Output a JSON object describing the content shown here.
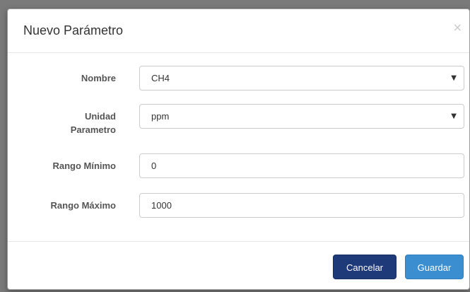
{
  "modal": {
    "title": "Nuevo Parámetro",
    "close_label": "×"
  },
  "form": {
    "fields": [
      {
        "label": "Nombre",
        "type": "select",
        "value": "CH4"
      },
      {
        "label_line1": "Unidad",
        "label_line2": "Parametro",
        "type": "select",
        "value": "ppm"
      },
      {
        "label": "Rango Mínimo",
        "type": "input",
        "value": "0"
      },
      {
        "label": "Rango Máximo",
        "type": "input",
        "value": "1000"
      }
    ],
    "select_arrow": "▼"
  },
  "footer": {
    "cancel_label": "Cancelar",
    "save_label": "Guardar"
  },
  "colors": {
    "cancel_button": "#1e3a78",
    "save_button": "#3b8fd0",
    "backdrop": "#7a7a7a"
  }
}
